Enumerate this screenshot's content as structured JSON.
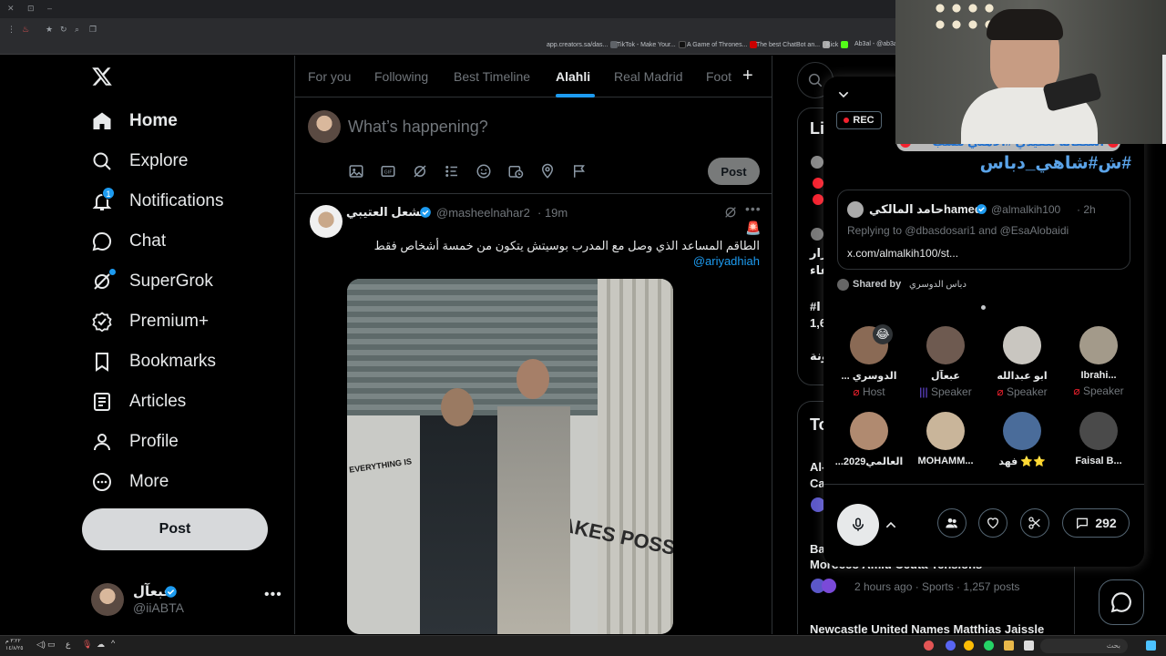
{
  "browser": {
    "bookmarks": [
      {
        "label": "app.creators.sa/das...",
        "color": "#5f6368"
      },
      {
        "label": "TikTok - Make Your...",
        "color": "#000000"
      },
      {
        "label": "A Game of Thrones...",
        "color": "#ffffff"
      },
      {
        "label": "The best ChatBot an...",
        "color": "#e53935"
      },
      {
        "label": "Kick",
        "color": "#53fc18"
      },
      {
        "label": "Ab3al - @ab3al",
        "color": "#53fc18"
      }
    ]
  },
  "sidebar": {
    "items": [
      {
        "label": "Home",
        "icon": "home-icon",
        "active": true
      },
      {
        "label": "Explore",
        "icon": "search-icon",
        "active": false
      },
      {
        "label": "Notifications",
        "icon": "bell-icon",
        "active": false,
        "badge": "1"
      },
      {
        "label": "Chat",
        "icon": "chat-icon",
        "active": false
      },
      {
        "label": "SuperGrok",
        "icon": "grok-icon",
        "active": false
      },
      {
        "label": "Premium+",
        "icon": "premium-icon",
        "active": false
      },
      {
        "label": "Bookmarks",
        "icon": "bookmark-icon",
        "active": false
      },
      {
        "label": "Articles",
        "icon": "article-icon",
        "active": false
      },
      {
        "label": "Profile",
        "icon": "profile-icon",
        "active": false
      },
      {
        "label": "More",
        "icon": "more-icon",
        "active": false
      }
    ],
    "post_label": "Post",
    "account": {
      "name": "عبعآل",
      "handle": "@iiABTA"
    }
  },
  "timeline": {
    "tabs": [
      "For you",
      "Following",
      "Best Timeline",
      "Alahli",
      "Real Madrid",
      "Foot"
    ],
    "active_tab": "Alahli",
    "compose_placeholder": "What’s happening?",
    "compose_post_label": "Post",
    "tweet": {
      "name": "مشعل العتيبي",
      "handle": "@masheelnahar2",
      "time": "· 19m",
      "emoji": "🚨",
      "text": "الطاقم المساعد الذي وصل مع المدرب بوسيتش يتكون من خمسة أشخاص فقط",
      "mention": "@ariyadhiah",
      "image_text_1": "EVERYTHING IS",
      "image_text_2": "MAKES POSS"
    }
  },
  "right": {
    "live_heading": "Li",
    "live_partial": [
      "قرار",
      "عاء",
      "#ا",
      "1,6",
      "ونة"
    ],
    "trends_heading": "To",
    "trend_partial": [
      "Al-",
      "Ca"
    ],
    "trend2": {
      "title_partial": "Ba",
      "title": "Morocco Amid Ceuta Tensions",
      "meta": "2 hours ago · Sports · 1,257 posts"
    },
    "trend3_title": "Newcastle United Names Matthias Jaissle"
  },
  "space": {
    "rec_label": "REC",
    "hashtag_line1": "استقالة تنفيذي #الاهلي مسب",
    "hashtag_line2": "#ش#شاهي_دباس",
    "shared_card": {
      "name": "حامد المالكيhamed",
      "handle": "@almalkih100",
      "time": "· 2h",
      "replying": "Replying to @dbasdosari1 and @EsaAlobaidi",
      "link": "x.com/almalkih100/st..."
    },
    "shared_by_label": "Shared by",
    "shared_by_name": "دباس الدوسري",
    "speakers": [
      {
        "name": "... الدوسري",
        "role": "Host",
        "color": "#8a6a55",
        "role_color": "#f4212e"
      },
      {
        "name": "عبعآل",
        "role": "Speaker",
        "color": "#6e5a50",
        "role_color": "#7856ff"
      },
      {
        "name": "ابو عبدالله",
        "role": "Speaker",
        "color": "#c9c6c0",
        "role_color": "#f4212e"
      },
      {
        "name": "Ibrahi...",
        "role": "Speaker",
        "color": "#a39a8a",
        "role_color": "#f4212e"
      },
      {
        "name": "...العالمي2029",
        "role": "Speaker",
        "color": "#b08a70"
      },
      {
        "name": "MOHAMM...",
        "role": "Speaker",
        "color": "#c9b59a"
      },
      {
        "name": "فهد ⭐⭐",
        "role": "Speaker",
        "color": "#4a6c9a"
      },
      {
        "name": "Faisal B...",
        "role": "Speaker",
        "color": "#4a4a4a"
      }
    ],
    "reply_count": "292"
  },
  "taskbar": {
    "clock_time": "٣:٢٢ م",
    "clock_date": "١٤/٨/٢٥",
    "search_placeholder": "بحث"
  }
}
